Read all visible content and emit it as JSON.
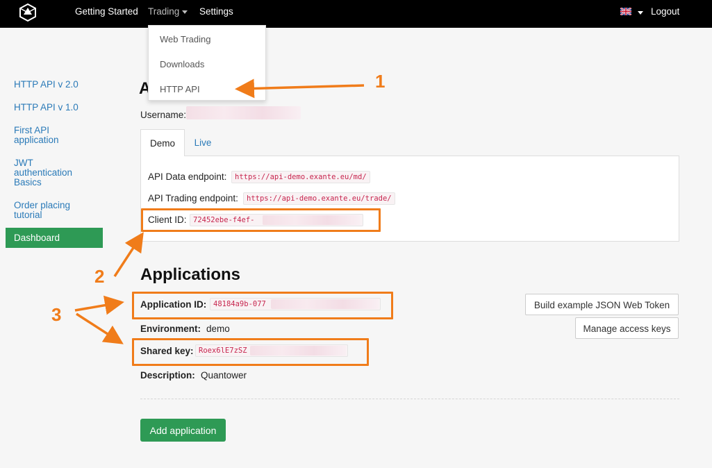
{
  "nav": {
    "items": [
      "Getting Started",
      "Trading",
      "Settings"
    ],
    "logout": "Logout"
  },
  "dropdown": {
    "items": [
      "Web Trading",
      "Downloads",
      "HTTP API"
    ]
  },
  "sidebar": {
    "items": [
      "HTTP API v 2.0",
      "HTTP API v 1.0",
      "First API application",
      "JWT authentication Basics",
      "Order placing tutorial"
    ],
    "active": "Dashboard"
  },
  "account": {
    "heading_fragment": "A",
    "username_label": "Username:"
  },
  "tabs": [
    "Demo",
    "Live"
  ],
  "endpoints": {
    "data_label": "API Data endpoint:",
    "data_url": "https://api-demo.exante.eu/md/",
    "trading_label": "API Trading endpoint:",
    "trading_url": "https://api-demo.exante.eu/trade/",
    "client_label": "Client ID:",
    "client_value": "72452ebe-f4ef-"
  },
  "applications": {
    "heading": "Applications",
    "app_id_label": "Application ID:",
    "app_id_value": "48184a9b-077",
    "environment_label": "Environment:",
    "environment_value": "demo",
    "shared_key_label": "Shared key:",
    "shared_key_value": "Roex6lE7zSZ",
    "description_label": "Description:",
    "description_value": "Quantower",
    "build_jwt_button": "Build example JSON Web Token",
    "manage_keys_button": "Manage access keys",
    "add_button": "Add application"
  },
  "callouts": [
    "1",
    "2",
    "3"
  ],
  "colors": {
    "accent_orange": "#f07c1a",
    "green": "#2e9a55",
    "link_blue": "#2a7ab8",
    "code_red": "#c7254e"
  }
}
